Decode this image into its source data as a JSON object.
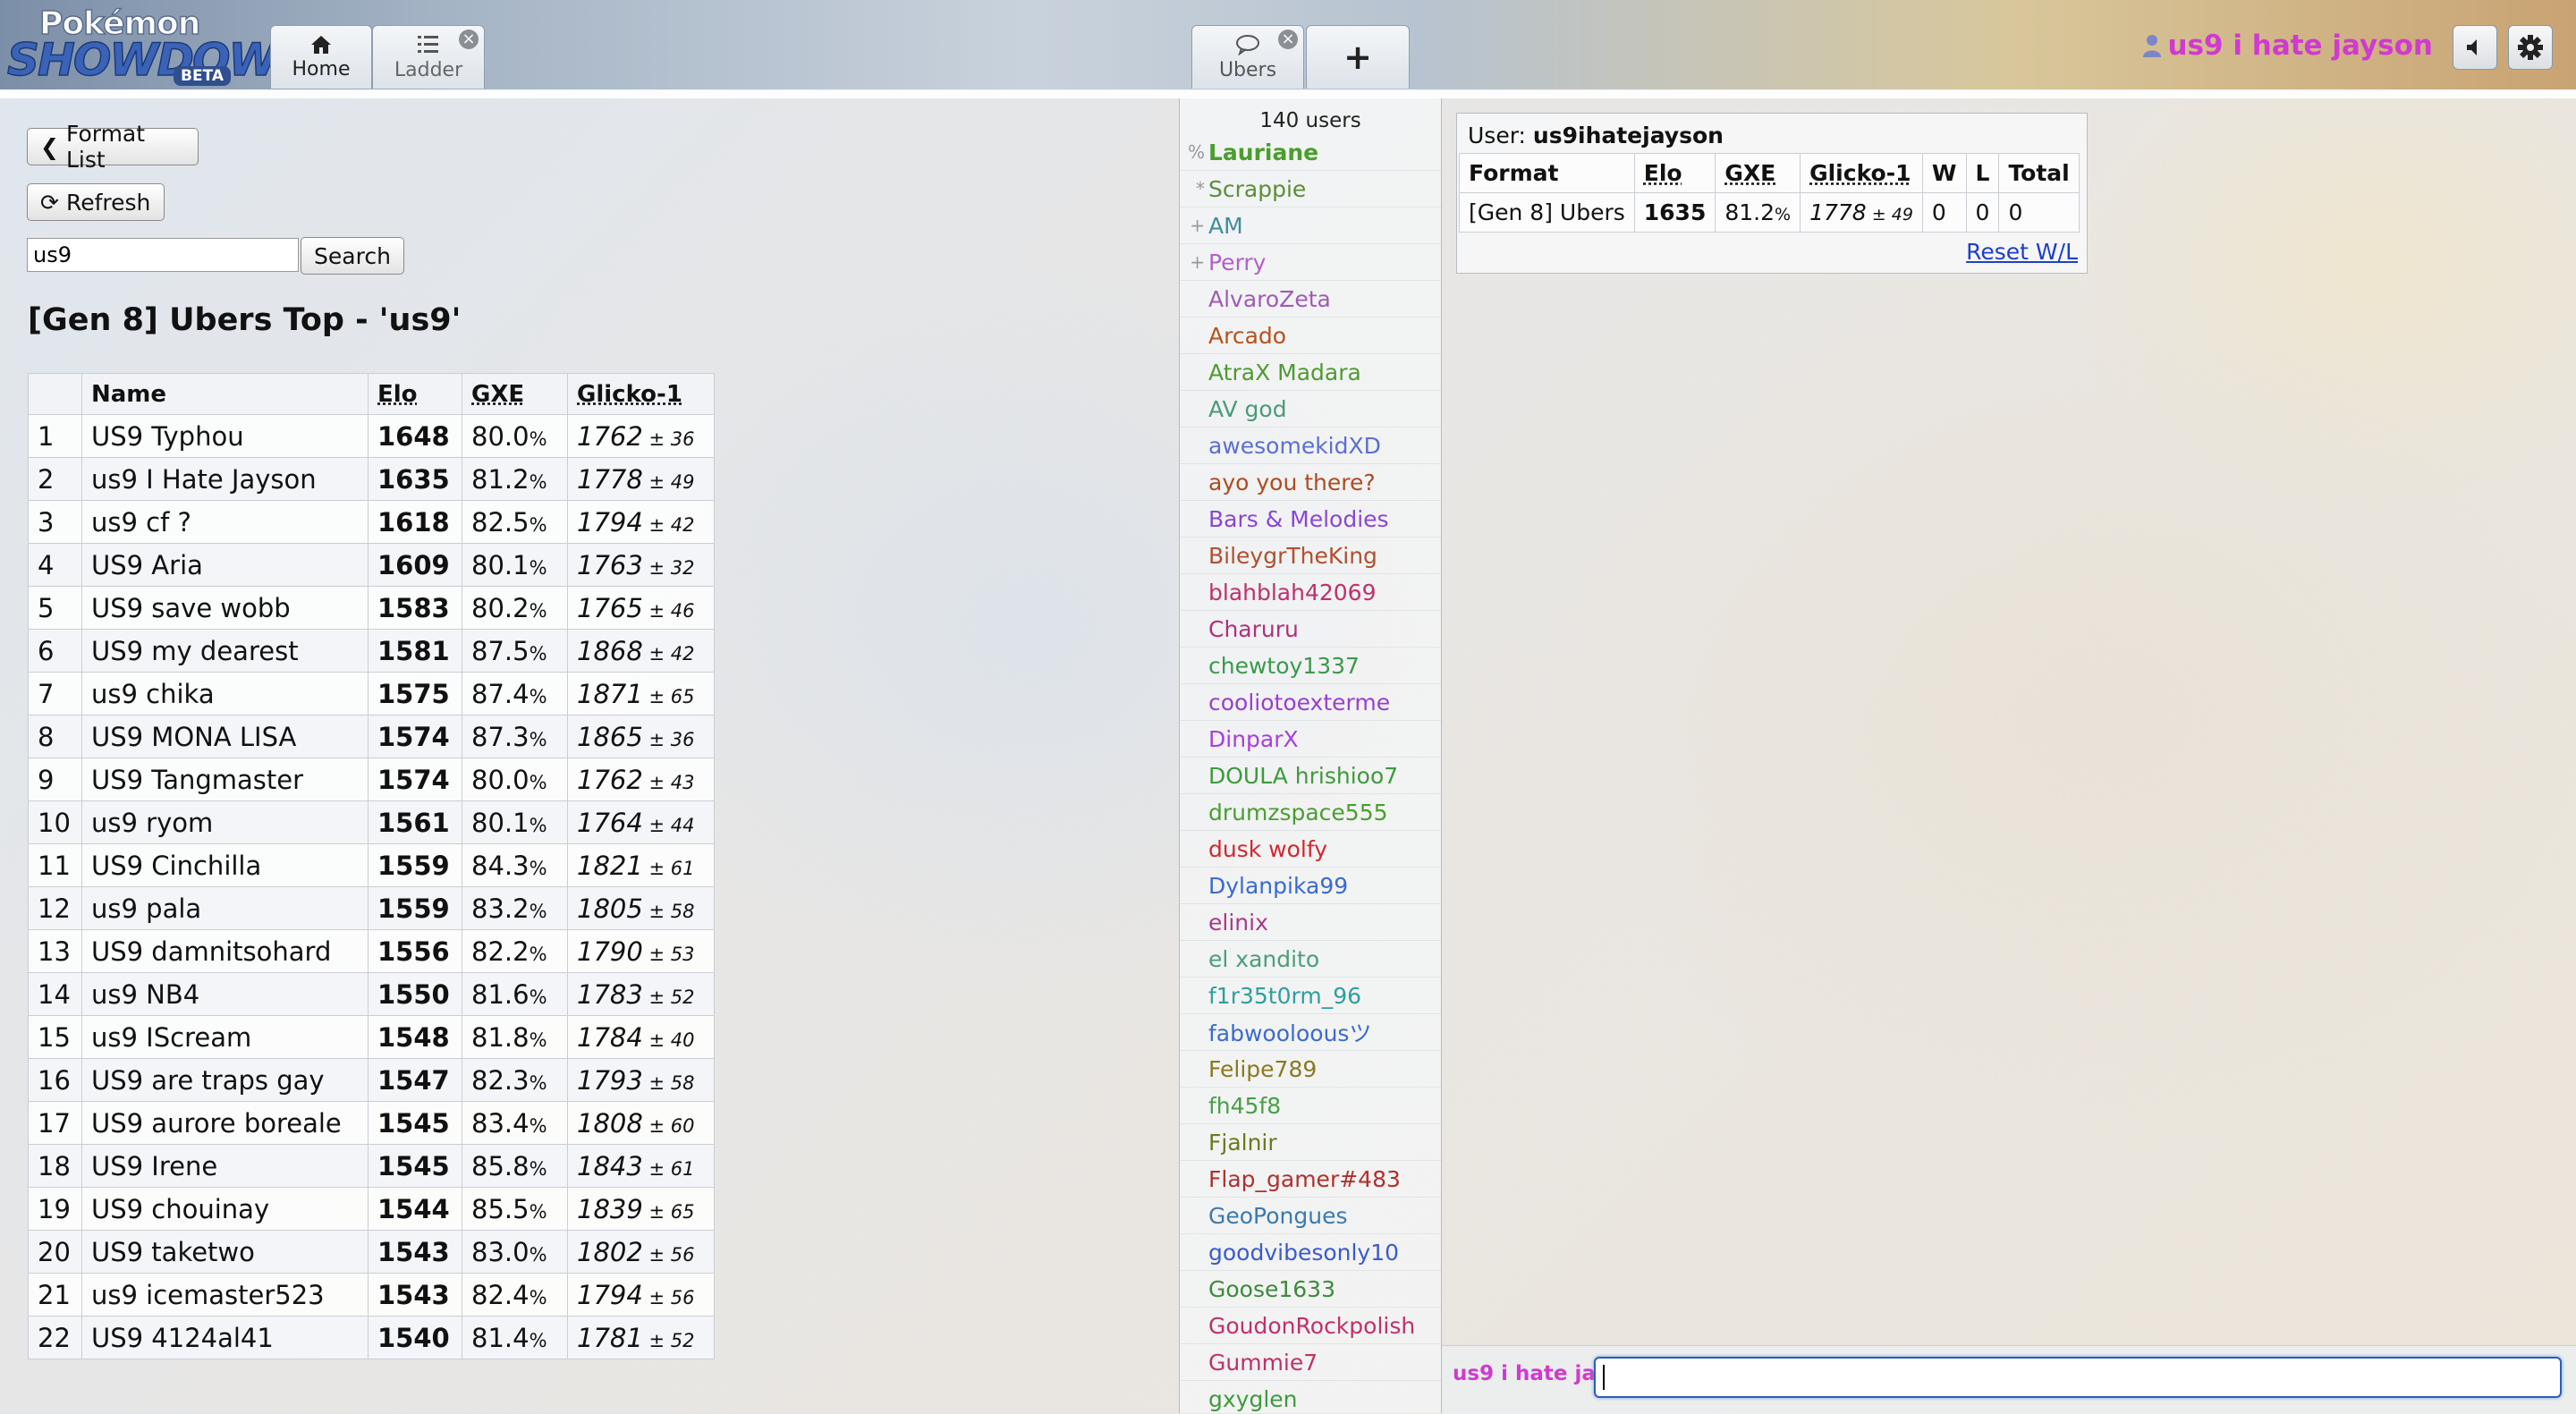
{
  "header": {
    "logo": {
      "line1": "Pokémon",
      "line2": "SHOWDOWN",
      "badge": "BETA"
    },
    "tabs": [
      {
        "label": "Home",
        "icon": "home-icon"
      },
      {
        "label": "Ladder",
        "icon": "list-icon",
        "closable": true
      },
      {
        "label": "Ubers",
        "icon": "chat-bubble-icon",
        "closable": true
      },
      {
        "label": "+",
        "icon": "plus-icon"
      }
    ],
    "username": "us9 i hate jayson",
    "close_glyph": "×",
    "colors": {
      "username": "#d03ad0"
    }
  },
  "ladder": {
    "format_list_label": "Format List",
    "refresh_label": "Refresh",
    "search_value": "us9",
    "search_button": "Search",
    "title": "[Gen 8] Ubers Top - 'us9'",
    "columns": [
      "",
      "Name",
      "Elo",
      "GXE",
      "Glicko-1"
    ],
    "rows": [
      {
        "rank": "1",
        "name": "US9 Typhou",
        "elo": "1648",
        "gxe": "80.0",
        "glicko": "1762",
        "dev": "36"
      },
      {
        "rank": "2",
        "name": "us9 I Hate Jayson",
        "elo": "1635",
        "gxe": "81.2",
        "glicko": "1778",
        "dev": "49"
      },
      {
        "rank": "3",
        "name": "us9 cf ?",
        "elo": "1618",
        "gxe": "82.5",
        "glicko": "1794",
        "dev": "42"
      },
      {
        "rank": "4",
        "name": "US9 Aria",
        "elo": "1609",
        "gxe": "80.1",
        "glicko": "1763",
        "dev": "32"
      },
      {
        "rank": "5",
        "name": "US9 save wobb",
        "elo": "1583",
        "gxe": "80.2",
        "glicko": "1765",
        "dev": "46"
      },
      {
        "rank": "6",
        "name": "US9 my dearest",
        "elo": "1581",
        "gxe": "87.5",
        "glicko": "1868",
        "dev": "42"
      },
      {
        "rank": "7",
        "name": "us9 chika",
        "elo": "1575",
        "gxe": "87.4",
        "glicko": "1871",
        "dev": "65"
      },
      {
        "rank": "8",
        "name": "US9 MONA LISA",
        "elo": "1574",
        "gxe": "87.3",
        "glicko": "1865",
        "dev": "36"
      },
      {
        "rank": "9",
        "name": "US9 Tangmaster",
        "elo": "1574",
        "gxe": "80.0",
        "glicko": "1762",
        "dev": "43"
      },
      {
        "rank": "10",
        "name": "us9 ryom",
        "elo": "1561",
        "gxe": "80.1",
        "glicko": "1764",
        "dev": "44"
      },
      {
        "rank": "11",
        "name": "US9 Cinchilla",
        "elo": "1559",
        "gxe": "84.3",
        "glicko": "1821",
        "dev": "61"
      },
      {
        "rank": "12",
        "name": "us9 pala",
        "elo": "1559",
        "gxe": "83.2",
        "glicko": "1805",
        "dev": "58"
      },
      {
        "rank": "13",
        "name": "US9 damnitsohard",
        "elo": "1556",
        "gxe": "82.2",
        "glicko": "1790",
        "dev": "53"
      },
      {
        "rank": "14",
        "name": "us9 NB4",
        "elo": "1550",
        "gxe": "81.6",
        "glicko": "1783",
        "dev": "52"
      },
      {
        "rank": "15",
        "name": "us9 IScream",
        "elo": "1548",
        "gxe": "81.8",
        "glicko": "1784",
        "dev": "40"
      },
      {
        "rank": "16",
        "name": "US9 are traps gay",
        "elo": "1547",
        "gxe": "82.3",
        "glicko": "1793",
        "dev": "58"
      },
      {
        "rank": "17",
        "name": "US9 aurore boreale",
        "elo": "1545",
        "gxe": "83.4",
        "glicko": "1808",
        "dev": "60"
      },
      {
        "rank": "18",
        "name": "US9 Irene",
        "elo": "1545",
        "gxe": "85.8",
        "glicko": "1843",
        "dev": "61"
      },
      {
        "rank": "19",
        "name": "US9 chouinay",
        "elo": "1544",
        "gxe": "85.5",
        "glicko": "1839",
        "dev": "65"
      },
      {
        "rank": "20",
        "name": "US9 taketwo",
        "elo": "1543",
        "gxe": "83.0",
        "glicko": "1802",
        "dev": "56"
      },
      {
        "rank": "21",
        "name": "us9 icemaster523",
        "elo": "1543",
        "gxe": "82.4",
        "glicko": "1794",
        "dev": "56"
      },
      {
        "rank": "22",
        "name": "US9 4124al41",
        "elo": "1540",
        "gxe": "81.4",
        "glicko": "1781",
        "dev": "52"
      }
    ],
    "percent_sign": "%",
    "plus_minus": "±"
  },
  "userlist": {
    "count": "140 users",
    "users": [
      {
        "sym": "%",
        "name": "Lauriane",
        "color": "#4a9e2e",
        "bold": true
      },
      {
        "sym": "*",
        "name": "Scrappie",
        "color": "#5b8e3a"
      },
      {
        "sym": "+",
        "name": "AM",
        "color": "#3f8ca0"
      },
      {
        "sym": "+",
        "name": "Perry",
        "color": "#b25fc9"
      },
      {
        "sym": "",
        "name": "AlvaroZeta",
        "color": "#a05ab8"
      },
      {
        "sym": "",
        "name": "Arcado",
        "color": "#b5521f"
      },
      {
        "sym": "",
        "name": "AtraX Madara",
        "color": "#4f9a32"
      },
      {
        "sym": "",
        "name": "AV god",
        "color": "#4a9a7a"
      },
      {
        "sym": "",
        "name": "awesomekidXD",
        "color": "#5b6fd1"
      },
      {
        "sym": "",
        "name": "ayo you there?",
        "color": "#b04a1e"
      },
      {
        "sym": "",
        "name": "Bars & Melodies",
        "color": "#8a46d6"
      },
      {
        "sym": "",
        "name": "BileygrTheKing",
        "color": "#b0502e"
      },
      {
        "sym": "",
        "name": "blahblah42069",
        "color": "#c0306a"
      },
      {
        "sym": "",
        "name": "Charuru",
        "color": "#b0307a"
      },
      {
        "sym": "",
        "name": "chewtoy1337",
        "color": "#3a9a4a"
      },
      {
        "sym": "",
        "name": "cooliotoexterme",
        "color": "#9a3ed0"
      },
      {
        "sym": "",
        "name": "DinparX",
        "color": "#a83ee0"
      },
      {
        "sym": "",
        "name": "DOULA hrishioo7",
        "color": "#3e9a3e"
      },
      {
        "sym": "",
        "name": "drumzspace555",
        "color": "#4a9e2e"
      },
      {
        "sym": "",
        "name": "dusk wolfy",
        "color": "#d0282e"
      },
      {
        "sym": "",
        "name": "Dylanpika99",
        "color": "#3a6ad0"
      },
      {
        "sym": "",
        "name": "elinix",
        "color": "#a83a8a"
      },
      {
        "sym": "",
        "name": "el xandito",
        "color": "#4a9e7a"
      },
      {
        "sym": "",
        "name": "f1r35t0rm_96",
        "color": "#2f9e9e"
      },
      {
        "sym": "",
        "name": "fabwooloousツ",
        "color": "#3a6ad0"
      },
      {
        "sym": "",
        "name": "Felipe789",
        "color": "#8a7a1e"
      },
      {
        "sym": "",
        "name": "fh45f8",
        "color": "#4a9e4a"
      },
      {
        "sym": "",
        "name": "Fjalnir",
        "color": "#6a7a1e"
      },
      {
        "sym": "",
        "name": "Flap_gamer#483",
        "color": "#b0302e"
      },
      {
        "sym": "",
        "name": "GeoPongues",
        "color": "#3a7ab0"
      },
      {
        "sym": "",
        "name": "goodvibesonly10",
        "color": "#3a5ad0"
      },
      {
        "sym": "",
        "name": "Goose1633",
        "color": "#3e8a3e"
      },
      {
        "sym": "",
        "name": "GoudonRockpolish",
        "color": "#c0306a"
      },
      {
        "sym": "",
        "name": "Gummie7",
        "color": "#c0306a"
      },
      {
        "sym": "",
        "name": "gxyglen",
        "color": "#3e9a3e"
      }
    ]
  },
  "userpanel": {
    "user_label": "User:",
    "user_name": "us9ihatejayson",
    "columns": [
      "Format",
      "Elo",
      "GXE",
      "Glicko-1",
      "W",
      "L",
      "Total"
    ],
    "row": {
      "format": "[Gen 8] Ubers",
      "elo": "1635",
      "gxe": "81.2",
      "glicko": "1778",
      "dev": "49",
      "w": "0",
      "l": "0",
      "total": "0"
    },
    "reset_label": "Reset W/L"
  },
  "chat": {
    "name_prefix": "us9 i hate ja",
    "input_value": ""
  }
}
